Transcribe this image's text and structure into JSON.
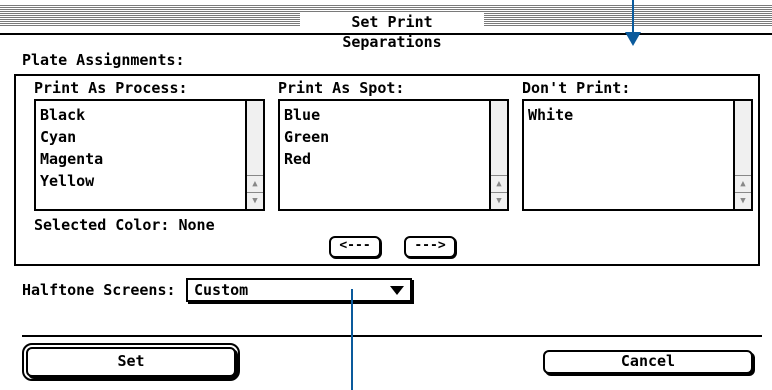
{
  "window": {
    "title": "Set Print Separations"
  },
  "plate": {
    "section_label": "Plate Assignments:",
    "process": {
      "label": "Print As Process:",
      "items": [
        "Black",
        "Cyan",
        "Magenta",
        "Yellow"
      ]
    },
    "spot": {
      "label": "Print As Spot:",
      "items": [
        "Blue",
        "Green",
        "Red"
      ]
    },
    "dont": {
      "label": "Don't Print:",
      "items": [
        "White"
      ]
    },
    "selected_label": "Selected Color: None",
    "move_left_label": "<---",
    "move_right_label": "--->"
  },
  "halftone": {
    "label": "Halftone Screens:",
    "value": "Custom"
  },
  "buttons": {
    "set_label": "Set",
    "cancel_label": "Cancel"
  },
  "colors": {
    "pointer": "#0a5a9c"
  }
}
